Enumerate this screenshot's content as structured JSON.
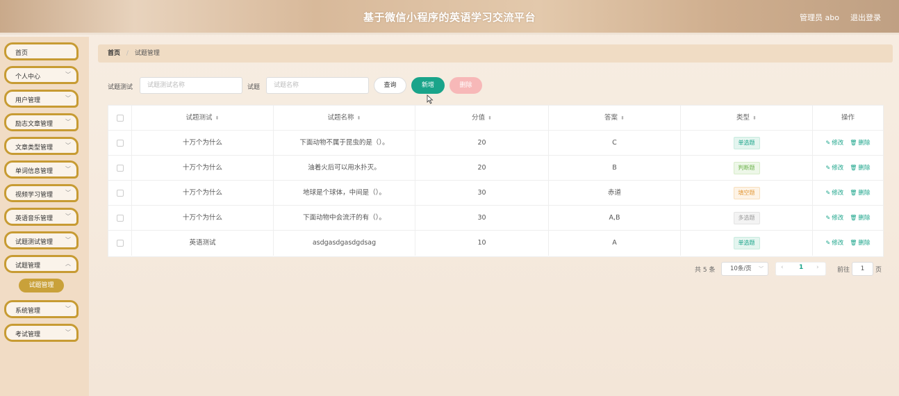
{
  "header": {
    "title": "基于微信小程序的英语学习交流平台",
    "user": "管理员 abo",
    "logout": "退出登录"
  },
  "sidebar": {
    "items": [
      {
        "label": "首页",
        "chevron": false
      },
      {
        "label": "个人中心",
        "chevron": true
      },
      {
        "label": "用户管理",
        "chevron": true
      },
      {
        "label": "励志文章管理",
        "chevron": true
      },
      {
        "label": "文章类型管理",
        "chevron": true
      },
      {
        "label": "单词信息管理",
        "chevron": true
      },
      {
        "label": "视频学习管理",
        "chevron": true
      },
      {
        "label": "英语音乐管理",
        "chevron": true
      },
      {
        "label": "试题测试管理",
        "chevron": true
      },
      {
        "label": "试题管理",
        "chevron": true
      },
      {
        "label": "系统管理",
        "chevron": true
      },
      {
        "label": "考试管理",
        "chevron": true
      }
    ],
    "submenu": "试题管理"
  },
  "breadcrumb": {
    "home": "首页",
    "current": "试题管理"
  },
  "search": {
    "label1": "试题测试",
    "placeholder1": "试题测试名称",
    "label2": "试题",
    "placeholder2": "试题名称",
    "query": "查询",
    "add": "新增",
    "delete": "删除"
  },
  "table": {
    "columns": [
      "试题测试",
      "试题名称",
      "分值",
      "答案",
      "类型",
      "操作"
    ],
    "edit": "修改",
    "remove": "删除",
    "rows": [
      {
        "test": "十万个为什么",
        "name": "下面动物不属于昆虫的是（）。",
        "score": "20",
        "answer": "C",
        "type": "单选题",
        "type_class": "tag-single"
      },
      {
        "test": "十万个为什么",
        "name": "油着火后可以用水扑灭。",
        "score": "20",
        "answer": "B",
        "type": "判断题",
        "type_class": "tag-judge"
      },
      {
        "test": "十万个为什么",
        "name": "地球是个球体，中间是（）。",
        "score": "30",
        "answer": "赤道",
        "type": "填空题",
        "type_class": "tag-fill"
      },
      {
        "test": "十万个为什么",
        "name": "下面动物中会流汗的有（）。",
        "score": "30",
        "answer": "A,B",
        "type": "多选题",
        "type_class": "tag-multi"
      },
      {
        "test": "英语测试",
        "name": "asdgasdgasdgdsag",
        "score": "10",
        "answer": "A",
        "type": "单选题",
        "type_class": "tag-single"
      }
    ]
  },
  "pager": {
    "total": "共 5 条",
    "size": "10条/页",
    "current": "1",
    "goto": "前往",
    "goto_value": "1",
    "page": "页"
  }
}
